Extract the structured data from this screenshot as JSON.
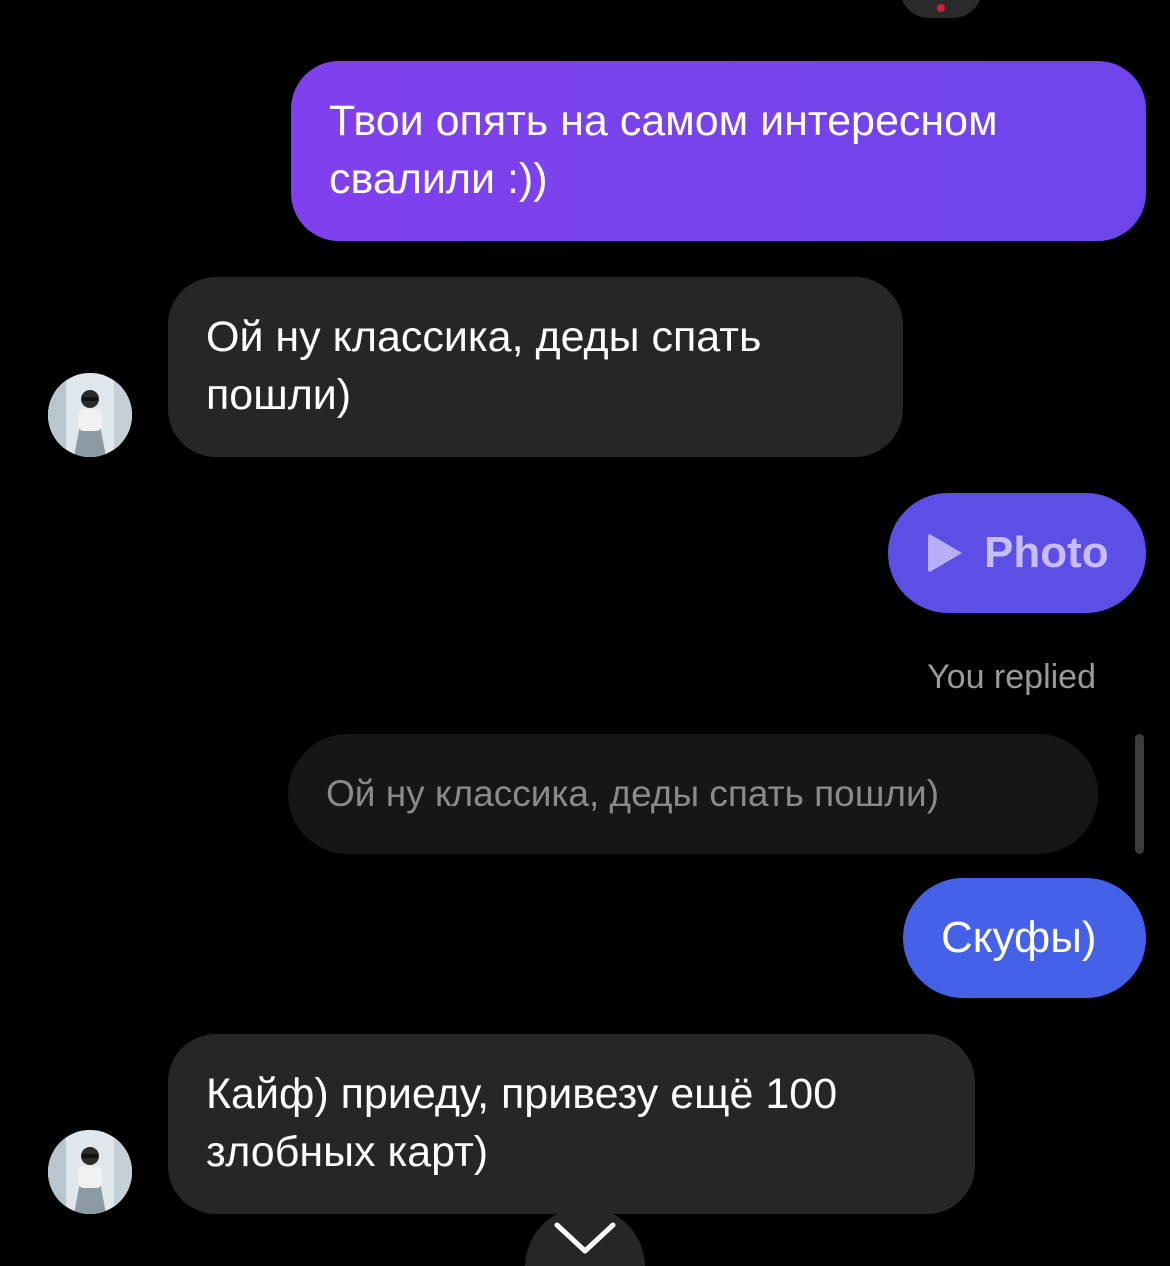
{
  "messages": [
    {
      "text": "Твои опять на самом интересном свалили :))"
    },
    {
      "text": "Ой ну классика, деды  спать пошли)"
    },
    {
      "label": "Photo"
    },
    {
      "text": "Скуфы)"
    },
    {
      "text": "Кайф) приеду, привезу ещё 100 злобных карт)"
    }
  ],
  "reply": {
    "status": "You replied",
    "quoted_text": "Ой ну классика, деды  спать пошли)"
  },
  "icons": {
    "play": "play-icon",
    "scroll": "chevron-down-icon",
    "avatar": "avatar"
  },
  "colors": {
    "background": "#000000",
    "outgoing_gradient_start": "#8140ee",
    "outgoing_gradient_end": "#6e45ea",
    "incoming": "#262626",
    "photo_bubble": "#5d4fe6",
    "outgoing_blue": "#4461e8"
  }
}
